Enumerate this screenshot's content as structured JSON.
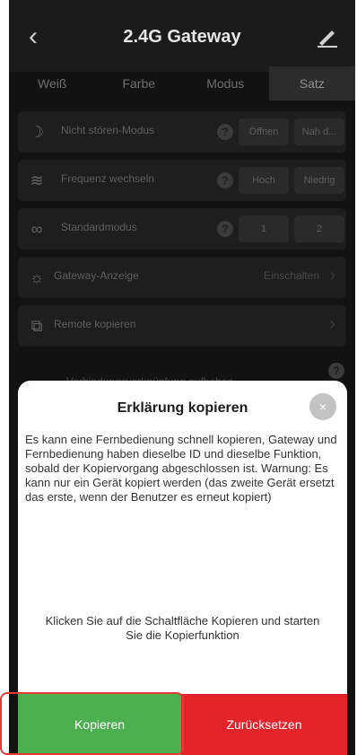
{
  "header": {
    "title": "2.4G Gateway",
    "back_icon": "chevron-left-icon",
    "edit_icon": "pencil-icon"
  },
  "tabs": [
    {
      "label": "Weiß"
    },
    {
      "label": "Farbe"
    },
    {
      "label": "Modus"
    },
    {
      "label": "Satz",
      "active": true
    }
  ],
  "settings": [
    {
      "icon": "moon-icon",
      "label": "Nicht stören-Modus",
      "help": "?",
      "options": [
        "Öffnen",
        "Nah d..."
      ]
    },
    {
      "icon": "waves-icon",
      "label": "Frequenz wechseln",
      "help": "?",
      "options": [
        "Hoch",
        "Niedrig"
      ]
    },
    {
      "icon": "grid-icon",
      "label": "Standardmodus",
      "help": "?",
      "options": [
        "1",
        "2"
      ]
    },
    {
      "icon": "sun-icon",
      "label": "Gateway-Anzeige",
      "value": "Einschalten"
    },
    {
      "icon": "copy-icon",
      "label": "Remote kopieren"
    }
  ],
  "partial_row": {
    "label": "Verbindungsverknüpfung aufheben",
    "help": "?"
  },
  "dialog": {
    "title": "Erklärung kopieren",
    "close_glyph": "×",
    "body": "Es kann eine Fernbedienung schnell kopieren, Gateway und Fernbedienung haben dieselbe ID und dieselbe Funktion, sobald der Kopiervorgang abgeschlossen ist. Warnung: Es kann nur ein Gerät kopiert werden (das zweite Gerät ersetzt das erste, wenn der Benutzer es erneut kopiert)",
    "hint": "Klicken Sie auf die Schaltfläche Kopieren und starten Sie die Kopierfunktion",
    "copy_label": "Kopieren",
    "reset_label": "Zurücksetzen"
  },
  "colors": {
    "accent_green": "#4caf50",
    "accent_red": "#e3242b",
    "highlight": "#e53935"
  }
}
